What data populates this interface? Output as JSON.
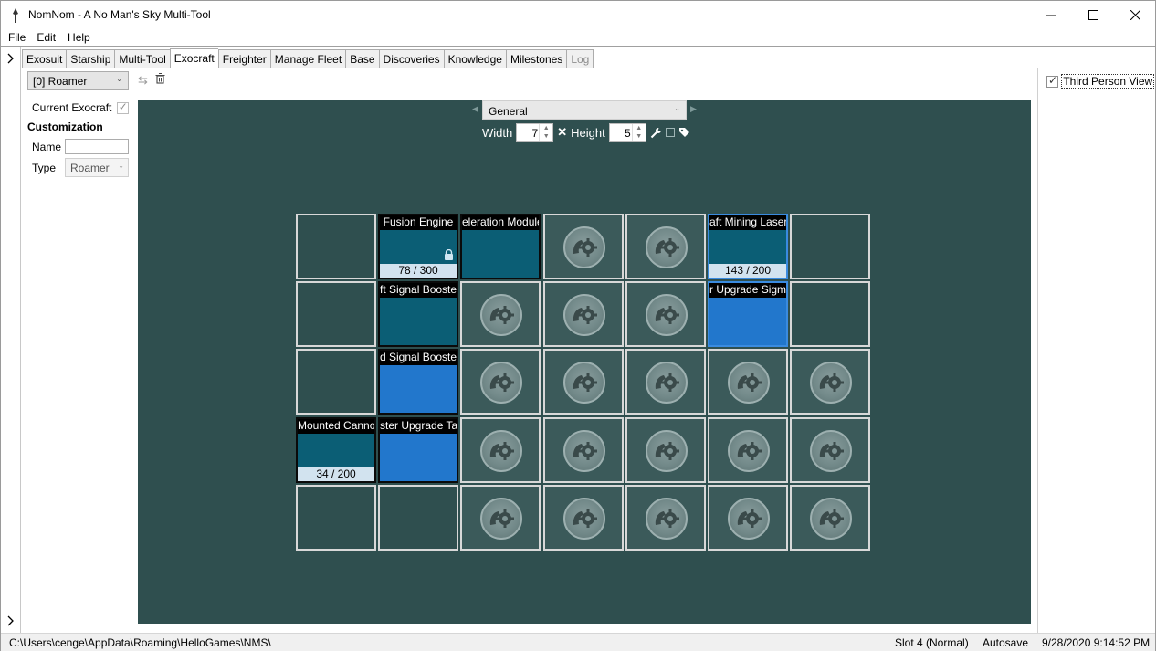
{
  "window": {
    "title": "NomNom - A No Man's Sky Multi-Tool",
    "minimize": "—",
    "maximize": "☐",
    "close": "✕"
  },
  "menu": {
    "file": "File",
    "edit": "Edit",
    "help": "Help"
  },
  "tabs": [
    {
      "label": "Exosuit"
    },
    {
      "label": "Starship"
    },
    {
      "label": "Multi-Tool"
    },
    {
      "label": "Exocraft"
    },
    {
      "label": "Freighter"
    },
    {
      "label": "Manage Fleet"
    },
    {
      "label": "Base"
    },
    {
      "label": "Discoveries"
    },
    {
      "label": "Knowledge"
    },
    {
      "label": "Milestones"
    },
    {
      "label": "Log"
    }
  ],
  "left_panel": {
    "selected_vehicle": "[0] Roamer",
    "current_exocraft_label": "Current Exocraft",
    "customization_heading": "Customization",
    "name_label": "Name",
    "name_value": "",
    "type_label": "Type",
    "type_value": "Roamer"
  },
  "inventory": {
    "selected": "General",
    "width_label": "Width",
    "width_value": "7",
    "height_label": "Height",
    "height_value": "5",
    "multiply_symbol": "✕",
    "slots": {
      "r0c1": {
        "name": "Fusion Engine",
        "charge": "78 / 300"
      },
      "r0c2": {
        "name": "eleration Module"
      },
      "r0c5": {
        "name": "aft Mining Laser",
        "charge": "143 / 200"
      },
      "r1c1": {
        "name": "ft Signal Booster"
      },
      "r1c5": {
        "name": "r Upgrade Sigm"
      },
      "r2c1": {
        "name": "d Signal Booster"
      },
      "r3c0": {
        "name": "Mounted Cannon",
        "charge": "34 / 200"
      },
      "r3c1": {
        "name": "ster Upgrade Ta"
      }
    }
  },
  "right_panel": {
    "third_person_label": "Third Person View"
  },
  "status": {
    "path": "C:\\Users\\cenge\\AppData\\Roaming\\HelloGames\\NMS\\",
    "slot": "Slot 4 (Normal)",
    "mode": "Autosave",
    "timestamp": "9/28/2020 9:14:52 PM"
  },
  "colors": {
    "inventory_bg": "#2f4f4f",
    "tech_item": "#0b5e75",
    "product_item": "#2277cc"
  }
}
